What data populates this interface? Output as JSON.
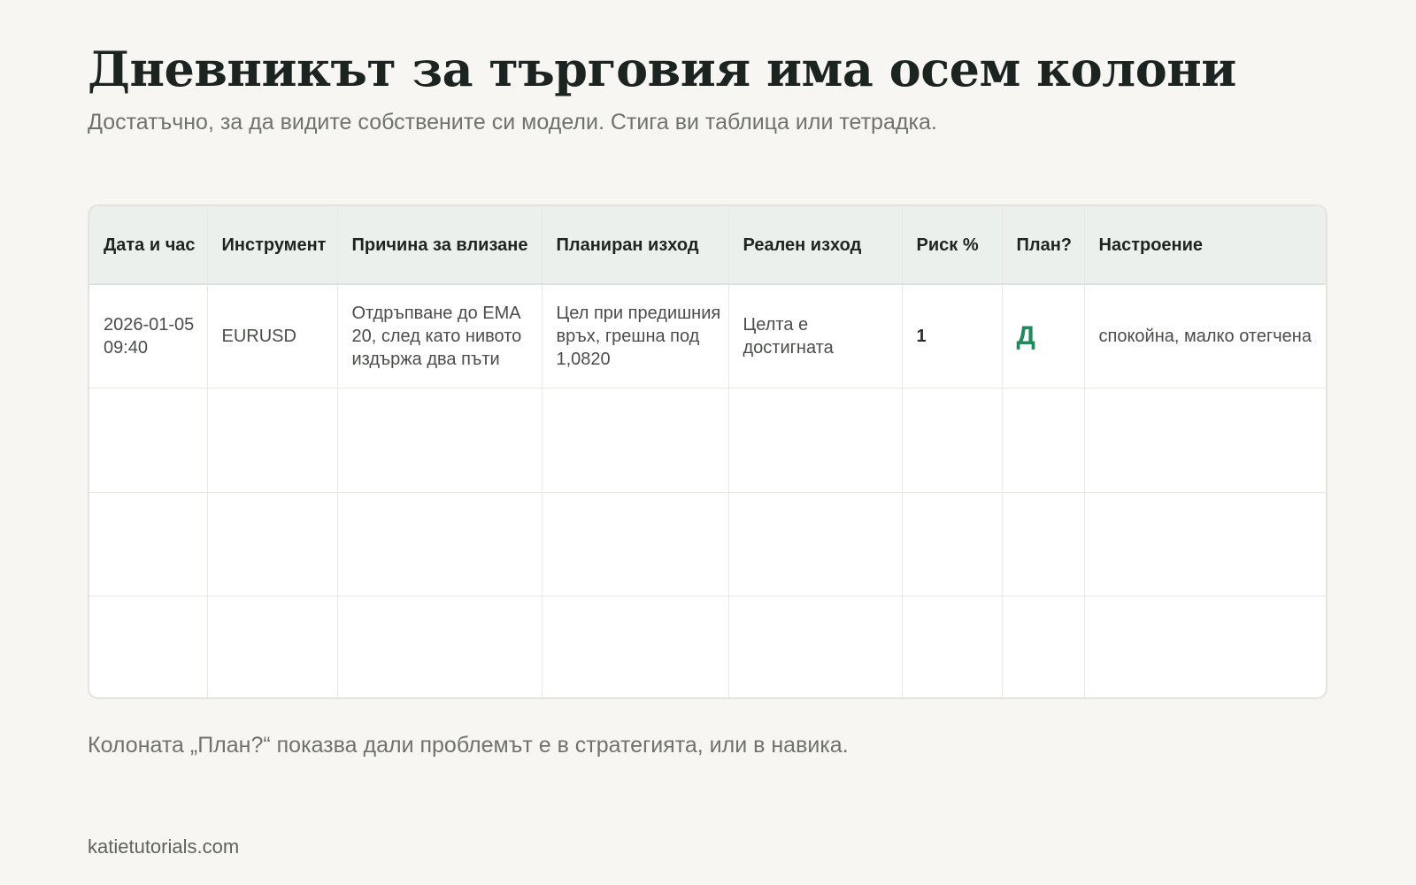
{
  "title": "Дневникът за търговия има осем колони",
  "subtitle": "Достатъчно, за да видите собствените си модели. Стига ви таблица или тетрадка.",
  "table": {
    "headers": [
      "Дата и час",
      "Инструмент",
      "Причина за влизане",
      "Планиран изход",
      "Реален изход",
      "Риск %",
      "План?",
      "Настроение"
    ],
    "rows": [
      [
        "2026-01-05 09:40",
        "EURUSD",
        "Отдръпване до EMA 20, след като нивото издържа два пъти",
        "Цел при предишния връх, грешна под 1,0820",
        "Целта е достигната",
        "1",
        "Д",
        "спокойна, малко отегчена"
      ],
      [
        "",
        "",
        "",
        "",
        "",
        "",
        "",
        ""
      ],
      [
        "",
        "",
        "",
        "",
        "",
        "",
        "",
        ""
      ],
      [
        "",
        "",
        "",
        "",
        "",
        "",
        "",
        ""
      ]
    ]
  },
  "footnote": "Колоната „План?“ показва дали проблемът е в стратегията, или в навика.",
  "site": "katietutorials.com",
  "colors": {
    "background": "#f7f6f3",
    "header_background": "#ebf0ec",
    "plan_yes": "#1f8a5c",
    "title": "#1b2420",
    "muted_text": "#6f726d"
  }
}
